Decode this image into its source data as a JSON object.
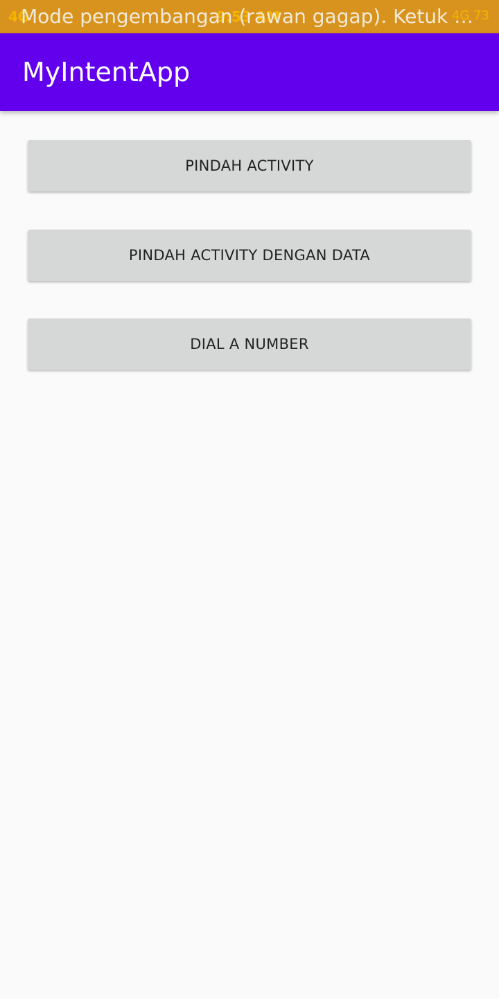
{
  "status_bar": {
    "left_text": "4G",
    "time": "9:53 AM",
    "right_text": "4G 73",
    "overlay_text": "Mode pengembangan (rawan gagap). Ketuk untuk..."
  },
  "app_bar": {
    "title": "MyIntentApp"
  },
  "buttons": [
    {
      "label": "PINDAH ACTIVITY"
    },
    {
      "label": "PINDAH ACTIVITY DENGAN DATA"
    },
    {
      "label": "DIAL A NUMBER"
    }
  ],
  "colors": {
    "status_bar": "#d8931f",
    "app_bar": "#6200ee",
    "button_bg": "#d6d7d7",
    "background": "#fafafa"
  }
}
